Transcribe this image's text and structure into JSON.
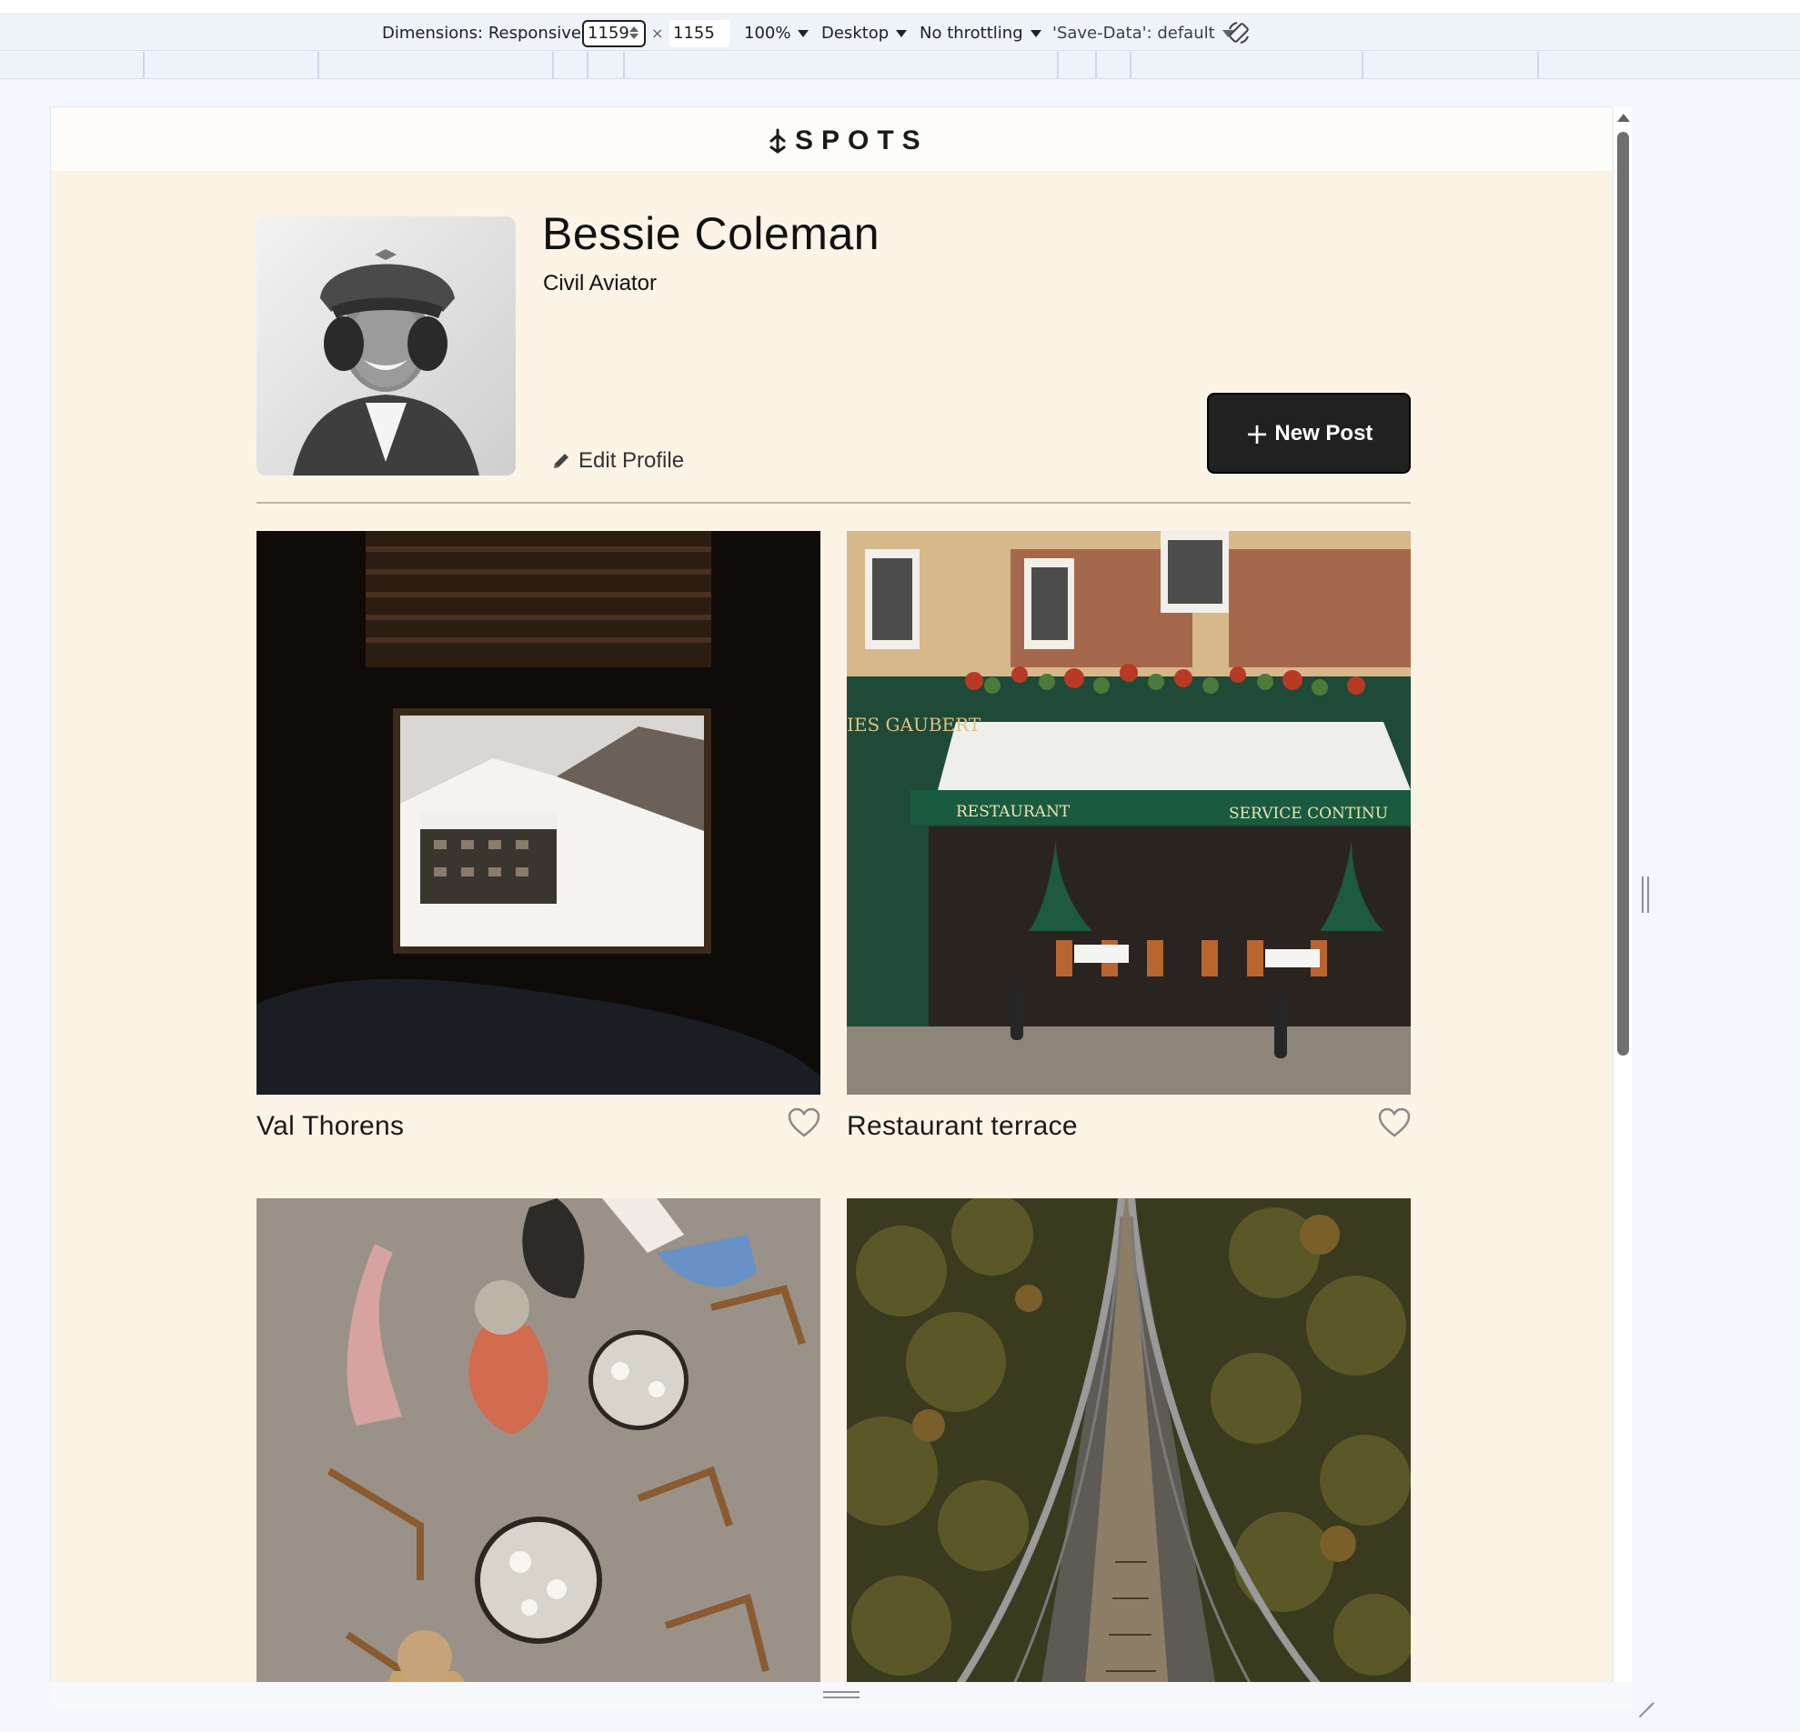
{
  "devtools": {
    "dimensions_label": "Dimensions: Responsive",
    "width_value": "1159",
    "times_sign": "×",
    "height_value": "1155",
    "zoom": "100%",
    "device_type": "Desktop",
    "throttling": "No throttling",
    "save_data": "'Save-Data': default",
    "rotate_icon": "rotate-icon"
  },
  "site": {
    "logo_text": "SPOTS",
    "logo_icon": "arrow-down-mark-icon"
  },
  "profile": {
    "name": "Bessie Coleman",
    "description": "Civil Aviator",
    "edit_label": "Edit Profile",
    "edit_icon": "pencil-icon",
    "new_post_label": "New Post",
    "new_post_icon": "plus-icon"
  },
  "cards": [
    {
      "title": "Val Thorens",
      "image": "snowy-mountain-resort-through-window",
      "liked": false
    },
    {
      "title": "Restaurant terrace",
      "image": "parisian-restaurant-facade-with-green-awning",
      "liked": false
    },
    {
      "title": "",
      "image": "outdoor-cafe-tables-from-above",
      "liked": false
    },
    {
      "title": "",
      "image": "suspension-bridge-over-forest",
      "liked": false
    }
  ],
  "colors": {
    "page_background": "#fbf4e6",
    "header_background": "#fefcf8",
    "button_dark": "#212121",
    "text_primary": "#111111"
  }
}
